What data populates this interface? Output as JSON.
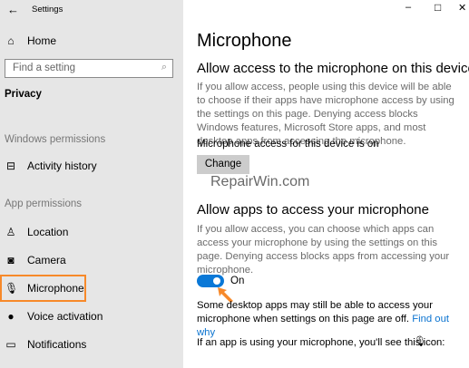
{
  "window": {
    "title": "Settings",
    "minimize": "–",
    "maximize": "□",
    "close": "✕"
  },
  "sidebar": {
    "home": "Home",
    "search_placeholder": "Find a setting",
    "section": "Privacy",
    "windows_permissions": "Windows permissions",
    "activity_history": "Activity history",
    "app_permissions": "App permissions",
    "items": [
      {
        "label": "Location"
      },
      {
        "label": "Camera"
      },
      {
        "label": "Microphone"
      },
      {
        "label": "Voice activation"
      },
      {
        "label": "Notifications"
      }
    ]
  },
  "main": {
    "title": "Microphone",
    "device_heading": "Allow access to the microphone on this device",
    "device_desc": "If you allow access, people using this device will be able to choose if their apps have microphone access by using the settings on this page. Denying access blocks Windows features, Microsoft Store apps, and most desktop apps from accessing the microphone.",
    "device_status": "Microphone access for this device is on",
    "change_label": "Change",
    "watermark": "RepairWin.com",
    "apps_heading": "Allow apps to access your microphone",
    "apps_desc": "If you allow access, you can choose which apps can access your microphone by using the settings on this page. Denying access blocks apps from accessing your microphone.",
    "toggle_state": "On",
    "desktop_note": "Some desktop apps may still be able to access your microphone when settings on this page are off.",
    "find_out_why": "Find out why",
    "icon_note": "If an app is using your microphone, you'll see this icon:"
  },
  "colors": {
    "accent": "#0a78d7",
    "highlight": "#f7892a"
  }
}
